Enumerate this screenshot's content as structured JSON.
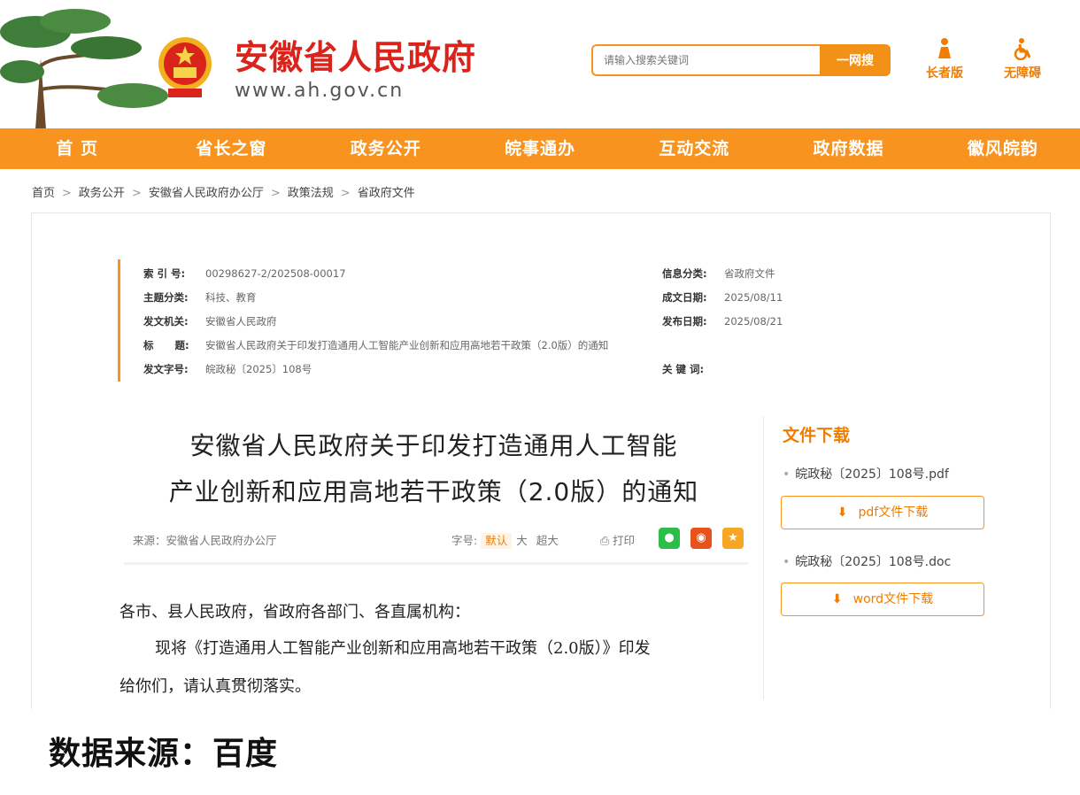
{
  "header": {
    "site_title": "安徽省人民政府",
    "site_url": "www.ah.gov.cn",
    "search_placeholder": "请输入搜索关键词",
    "search_button": "一网搜",
    "elder_mode": "长者版",
    "accessibility": "无障碍"
  },
  "nav": [
    "首 页",
    "省长之窗",
    "政务公开",
    "皖事通办",
    "互动交流",
    "政府数据",
    "徽风皖韵"
  ],
  "breadcrumb": [
    "首页",
    "政务公开",
    "安徽省人民政府办公厅",
    "政策法规",
    "省政府文件"
  ],
  "meta": {
    "index_no_label": "索 引 号:",
    "index_no": "00298627-2/202508-00017",
    "info_category_label": "信息分类:",
    "info_category": "省政府文件",
    "topic_label": "主题分类:",
    "topic": "科技、教育",
    "created_date_label": "成文日期:",
    "created_date": "2025/08/11",
    "issuer_label": "发文机关:",
    "issuer": "安徽省人民政府",
    "publish_date_label": "发布日期:",
    "publish_date": "2025/08/21",
    "title_label": "标      题:",
    "title": "安徽省人民政府关于印发打造通用人工智能产业创新和应用高地若干政策（2.0版）的通知",
    "doc_no_label": "发文字号:",
    "doc_no": "皖政秘〔2025〕108号",
    "keywords_label": "关 键 词:",
    "keywords": ""
  },
  "article": {
    "title_line1": "安徽省人民政府关于印发打造通用人工智能",
    "title_line2": "产业创新和应用高地若干政策（2.0版）的通知",
    "source": "来源：安徽省人民政府办公厅",
    "font_size_label": "字号:",
    "font_sizes": [
      "默认",
      "大",
      "超大"
    ],
    "print_label": "打印",
    "para1": "各市、县人民政府，省政府各部门、各直属机构：",
    "para2_line1": "现将《打造通用人工智能产业创新和应用高地若干政策（2.0版）》印发",
    "para2_line2": "给你们，请认真贯彻落实。"
  },
  "downloads": {
    "title": "文件下载",
    "files": [
      {
        "name": "皖政秘〔2025〕108号.pdf",
        "button": "pdf文件下载"
      },
      {
        "name": "皖政秘〔2025〕108号.doc",
        "button": "word文件下载"
      }
    ]
  },
  "footer_note": "数据来源：百度",
  "colors": {
    "accent": "#f7931e",
    "title_red": "#d9231b"
  }
}
